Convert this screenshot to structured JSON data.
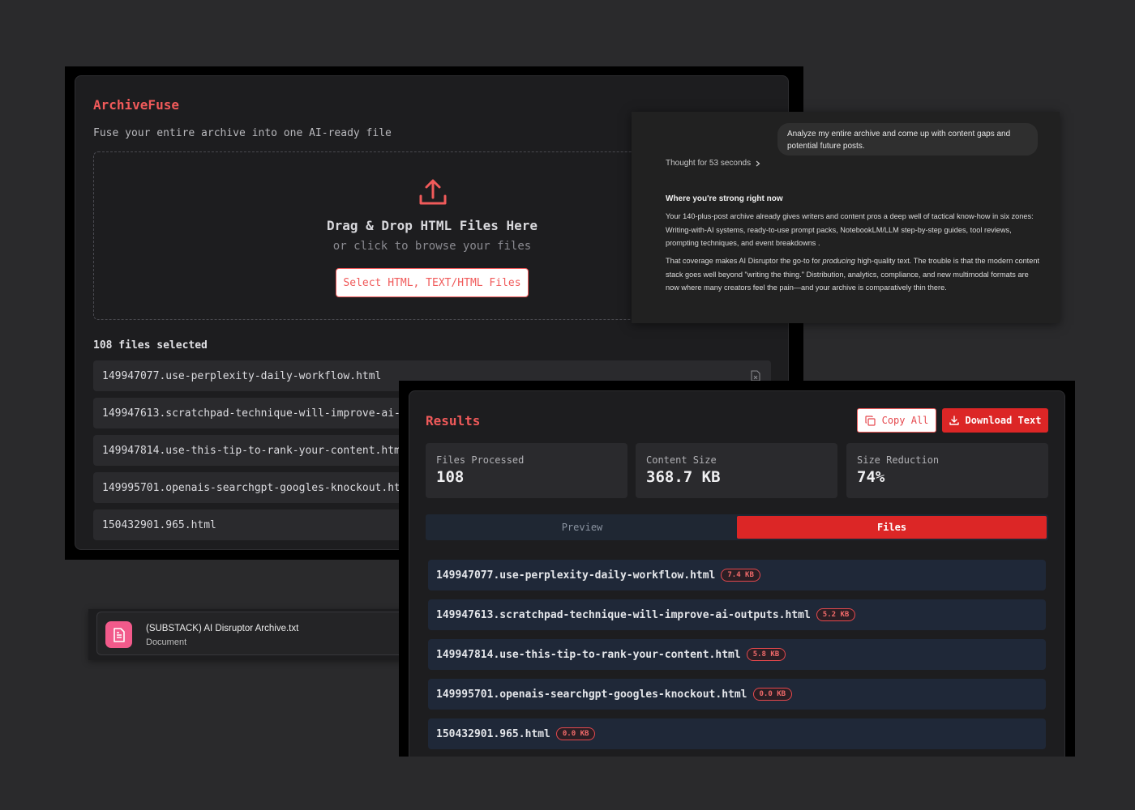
{
  "archivefuse": {
    "title": "ArchiveFuse",
    "subtitle": "Fuse your entire archive into one AI-ready file",
    "dropzone": {
      "title": "Drag & Drop HTML Files Here",
      "subtitle": "or click to browse your files",
      "button_label": "Select HTML, TEXT/HTML Files"
    },
    "files_selected": "108 files selected",
    "files": [
      "149947077.use-perplexity-daily-workflow.html",
      "149947613.scratchpad-technique-will-improve-ai-outputs.html",
      "149947814.use-this-tip-to-rank-your-content.html",
      "149995701.openais-searchgpt-googles-knockout.html",
      "150432901.965.html"
    ]
  },
  "chat": {
    "user_message": "Analyze my entire archive and come up with content gaps and potential future posts.",
    "thought": "Thought for 53 seconds",
    "heading": "Where you're strong right now",
    "para1": "Your 140-plus-post archive already gives writers and content pros a deep well of tactical know-how in six zones: Writing-with-AI systems, ready-to-use prompt packs, NotebookLM/LLM step-by-step guides, tool reviews, prompting techniques, and event breakdowns .",
    "para2_before": "That coverage makes AI Disruptor the go-to for ",
    "para2_em": "producing",
    "para2_after": " high-quality text. The trouble is that the modern content stack goes well beyond \"writing the thing.\" Distribution, analytics, compliance, and new multimodal formats are now where many creators feel the pain—and your archive is comparatively thin there."
  },
  "document": {
    "name": "(SUBSTACK) AI Disruptor Archive.txt",
    "type": "Document"
  },
  "results": {
    "title": "Results",
    "copy_label": "Copy All",
    "download_label": "Download Text",
    "stats": [
      {
        "label": "Files Processed",
        "value": "108"
      },
      {
        "label": "Content Size",
        "value": "368.7 KB"
      },
      {
        "label": "Size Reduction",
        "value": "74%"
      }
    ],
    "tabs": {
      "preview": "Preview",
      "files": "Files",
      "active": "Files"
    },
    "files": [
      {
        "name": "149947077.use-perplexity-daily-workflow.html",
        "size": "7.4 KB"
      },
      {
        "name": "149947613.scratchpad-technique-will-improve-ai-outputs.html",
        "size": "5.2 KB"
      },
      {
        "name": "149947814.use-this-tip-to-rank-your-content.html",
        "size": "5.8 KB"
      },
      {
        "name": "149995701.openais-searchgpt-googles-knockout.html",
        "size": "0.0 KB"
      },
      {
        "name": "150432901.965.html",
        "size": "0.0 KB"
      }
    ]
  },
  "colors": {
    "accent": "#f05a5a",
    "primary_red": "#dc2626",
    "doc_icon": "#f25a8b"
  }
}
